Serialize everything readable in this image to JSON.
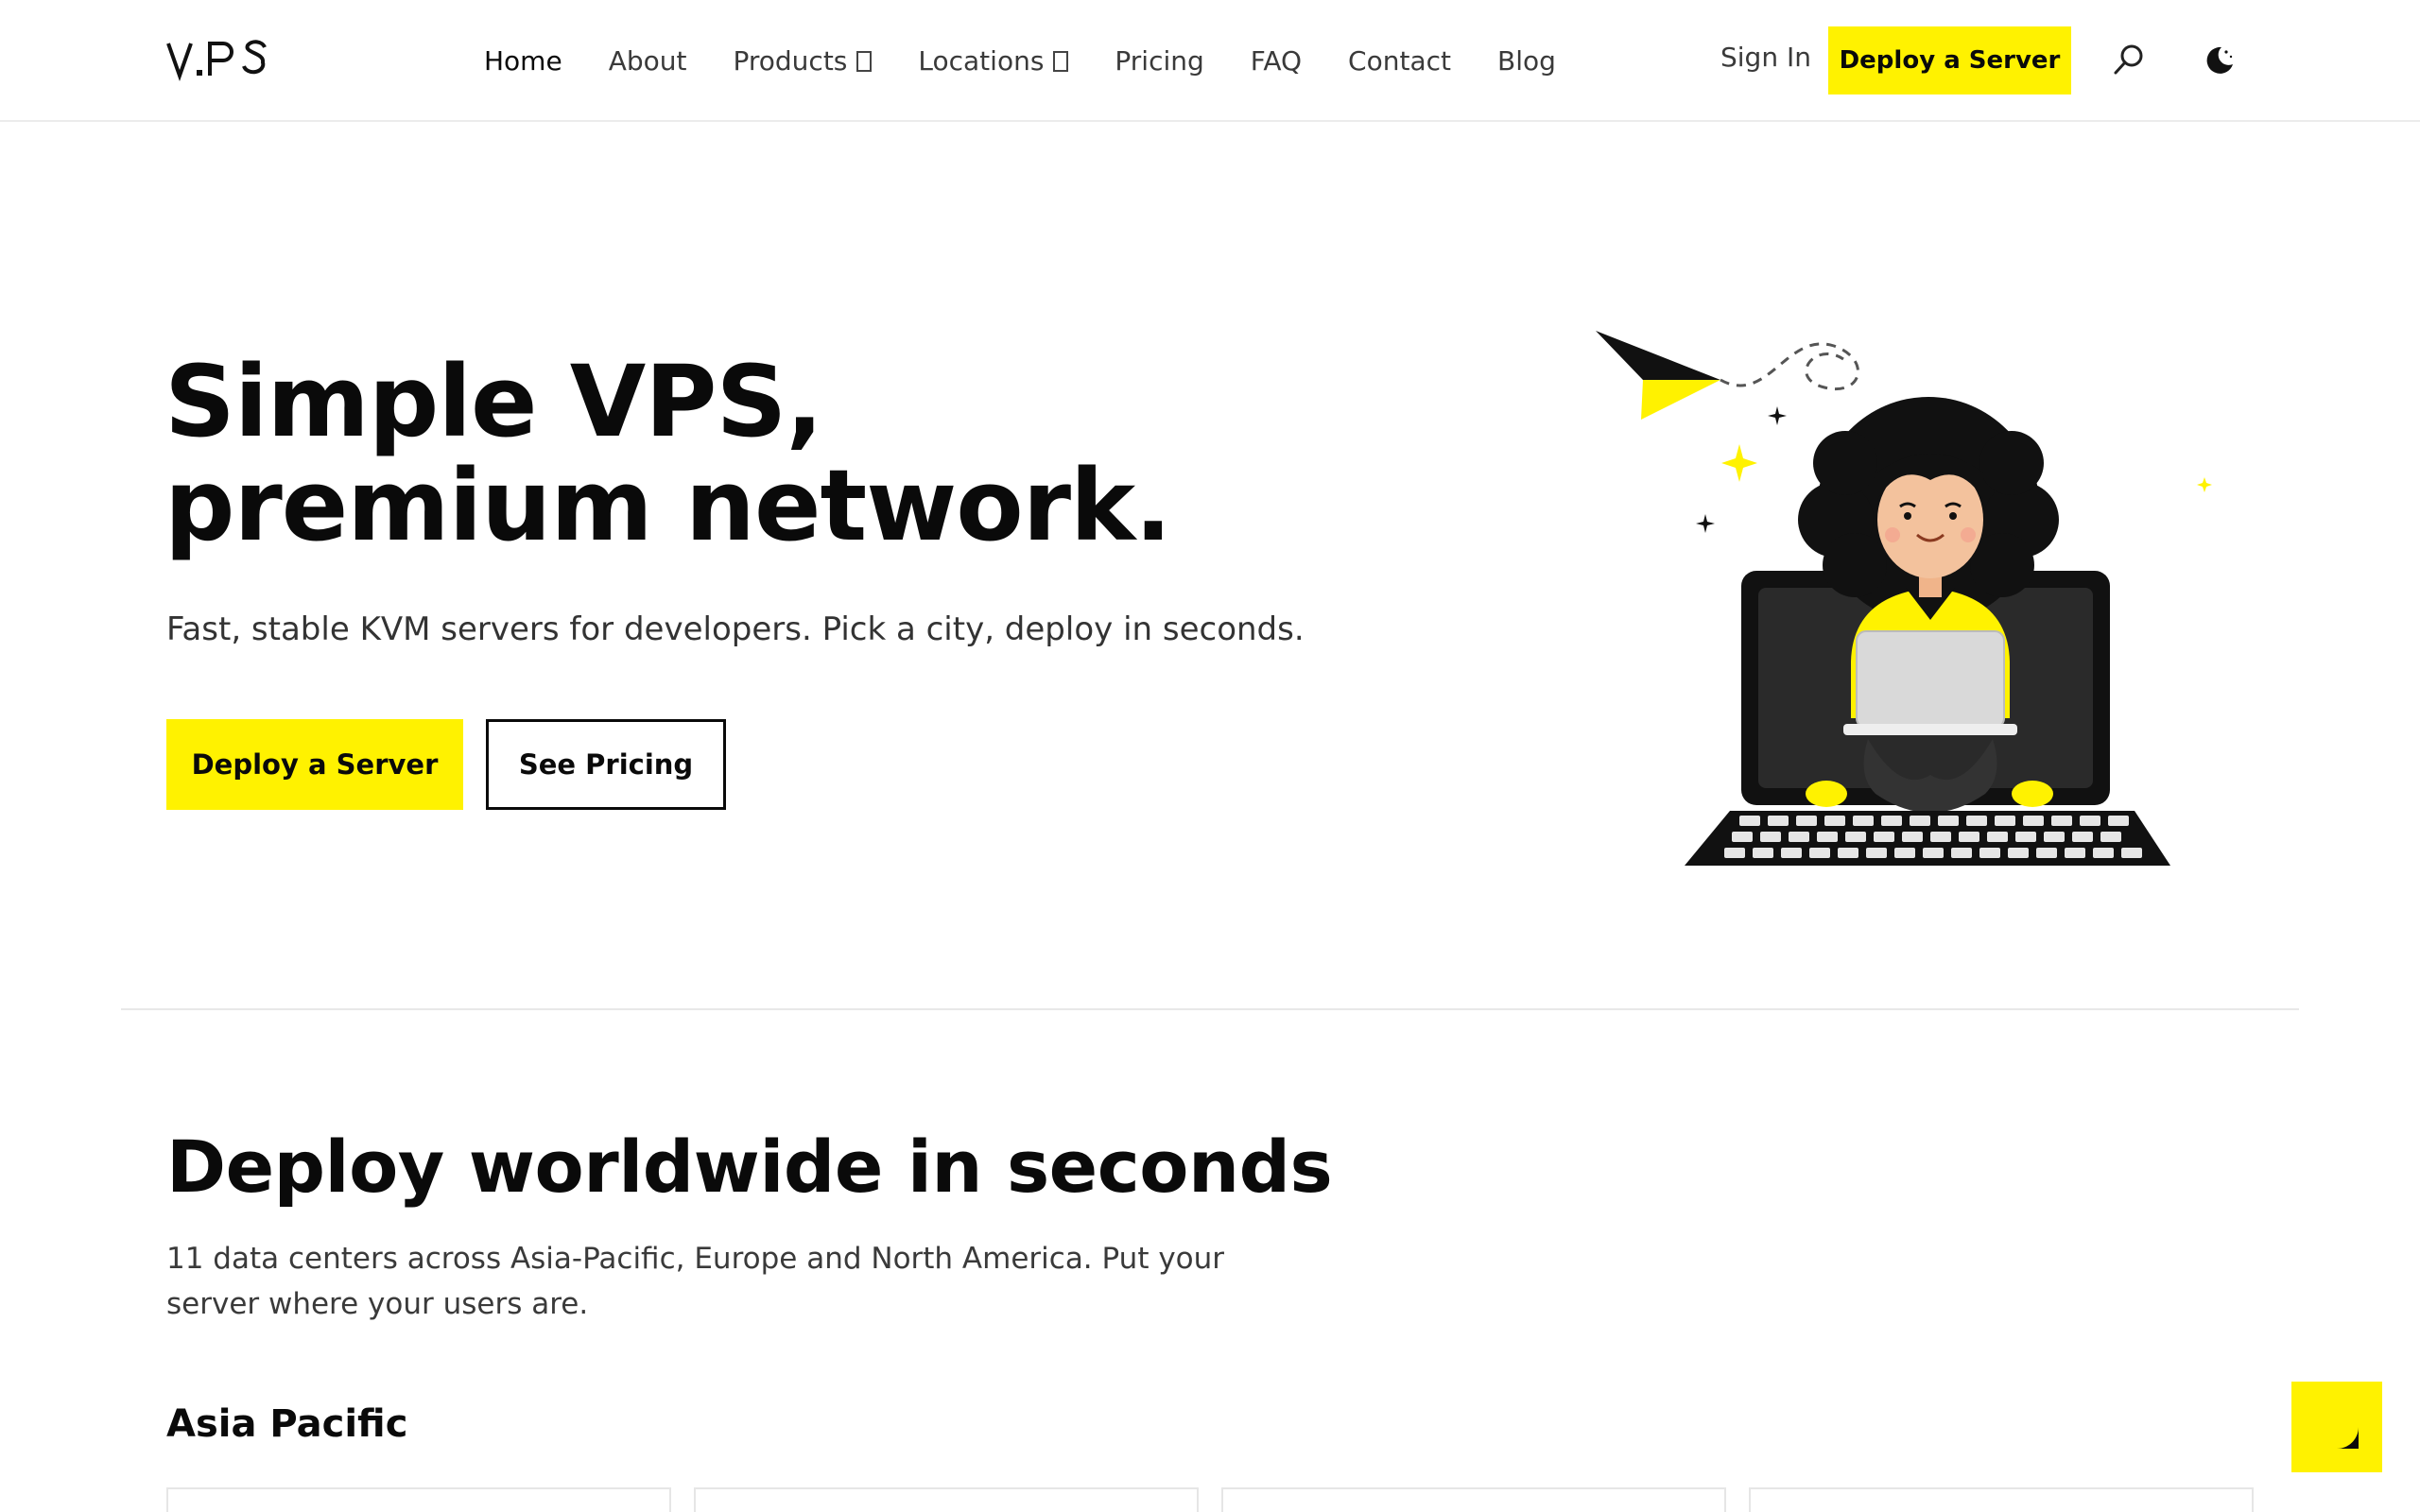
{
  "brand": {
    "logo_text": "V.PS",
    "accent": "#fff200"
  },
  "nav": {
    "links": [
      {
        "label": "Home",
        "active": true
      },
      {
        "label": "About"
      },
      {
        "label": "Products",
        "dropdown": true
      },
      {
        "label": "Locations",
        "dropdown": true
      },
      {
        "label": "Pricing"
      },
      {
        "label": "FAQ"
      },
      {
        "label": "Contact"
      },
      {
        "label": "Blog"
      }
    ],
    "sign_in": "Sign In",
    "deploy_label": "Deploy a Server",
    "search_icon": "search-icon",
    "theme_icon": "moon-icon"
  },
  "hero": {
    "title_line1": "Simple VPS,",
    "title_line2": "premium network.",
    "subtitle": "Fast, stable KVM servers for developers. Pick a city, deploy in seconds.",
    "primary_button": "Deploy a Server",
    "secondary_button": "See Pricing"
  },
  "deploy": {
    "title": "Deploy worldwide in seconds",
    "subtitle": "11 data centers across Asia-Pacific, Europe and North America. Put your server where your users are.",
    "region_title": "Asia Pacific"
  },
  "chat": {
    "icon": "chat-bubble-icon"
  }
}
